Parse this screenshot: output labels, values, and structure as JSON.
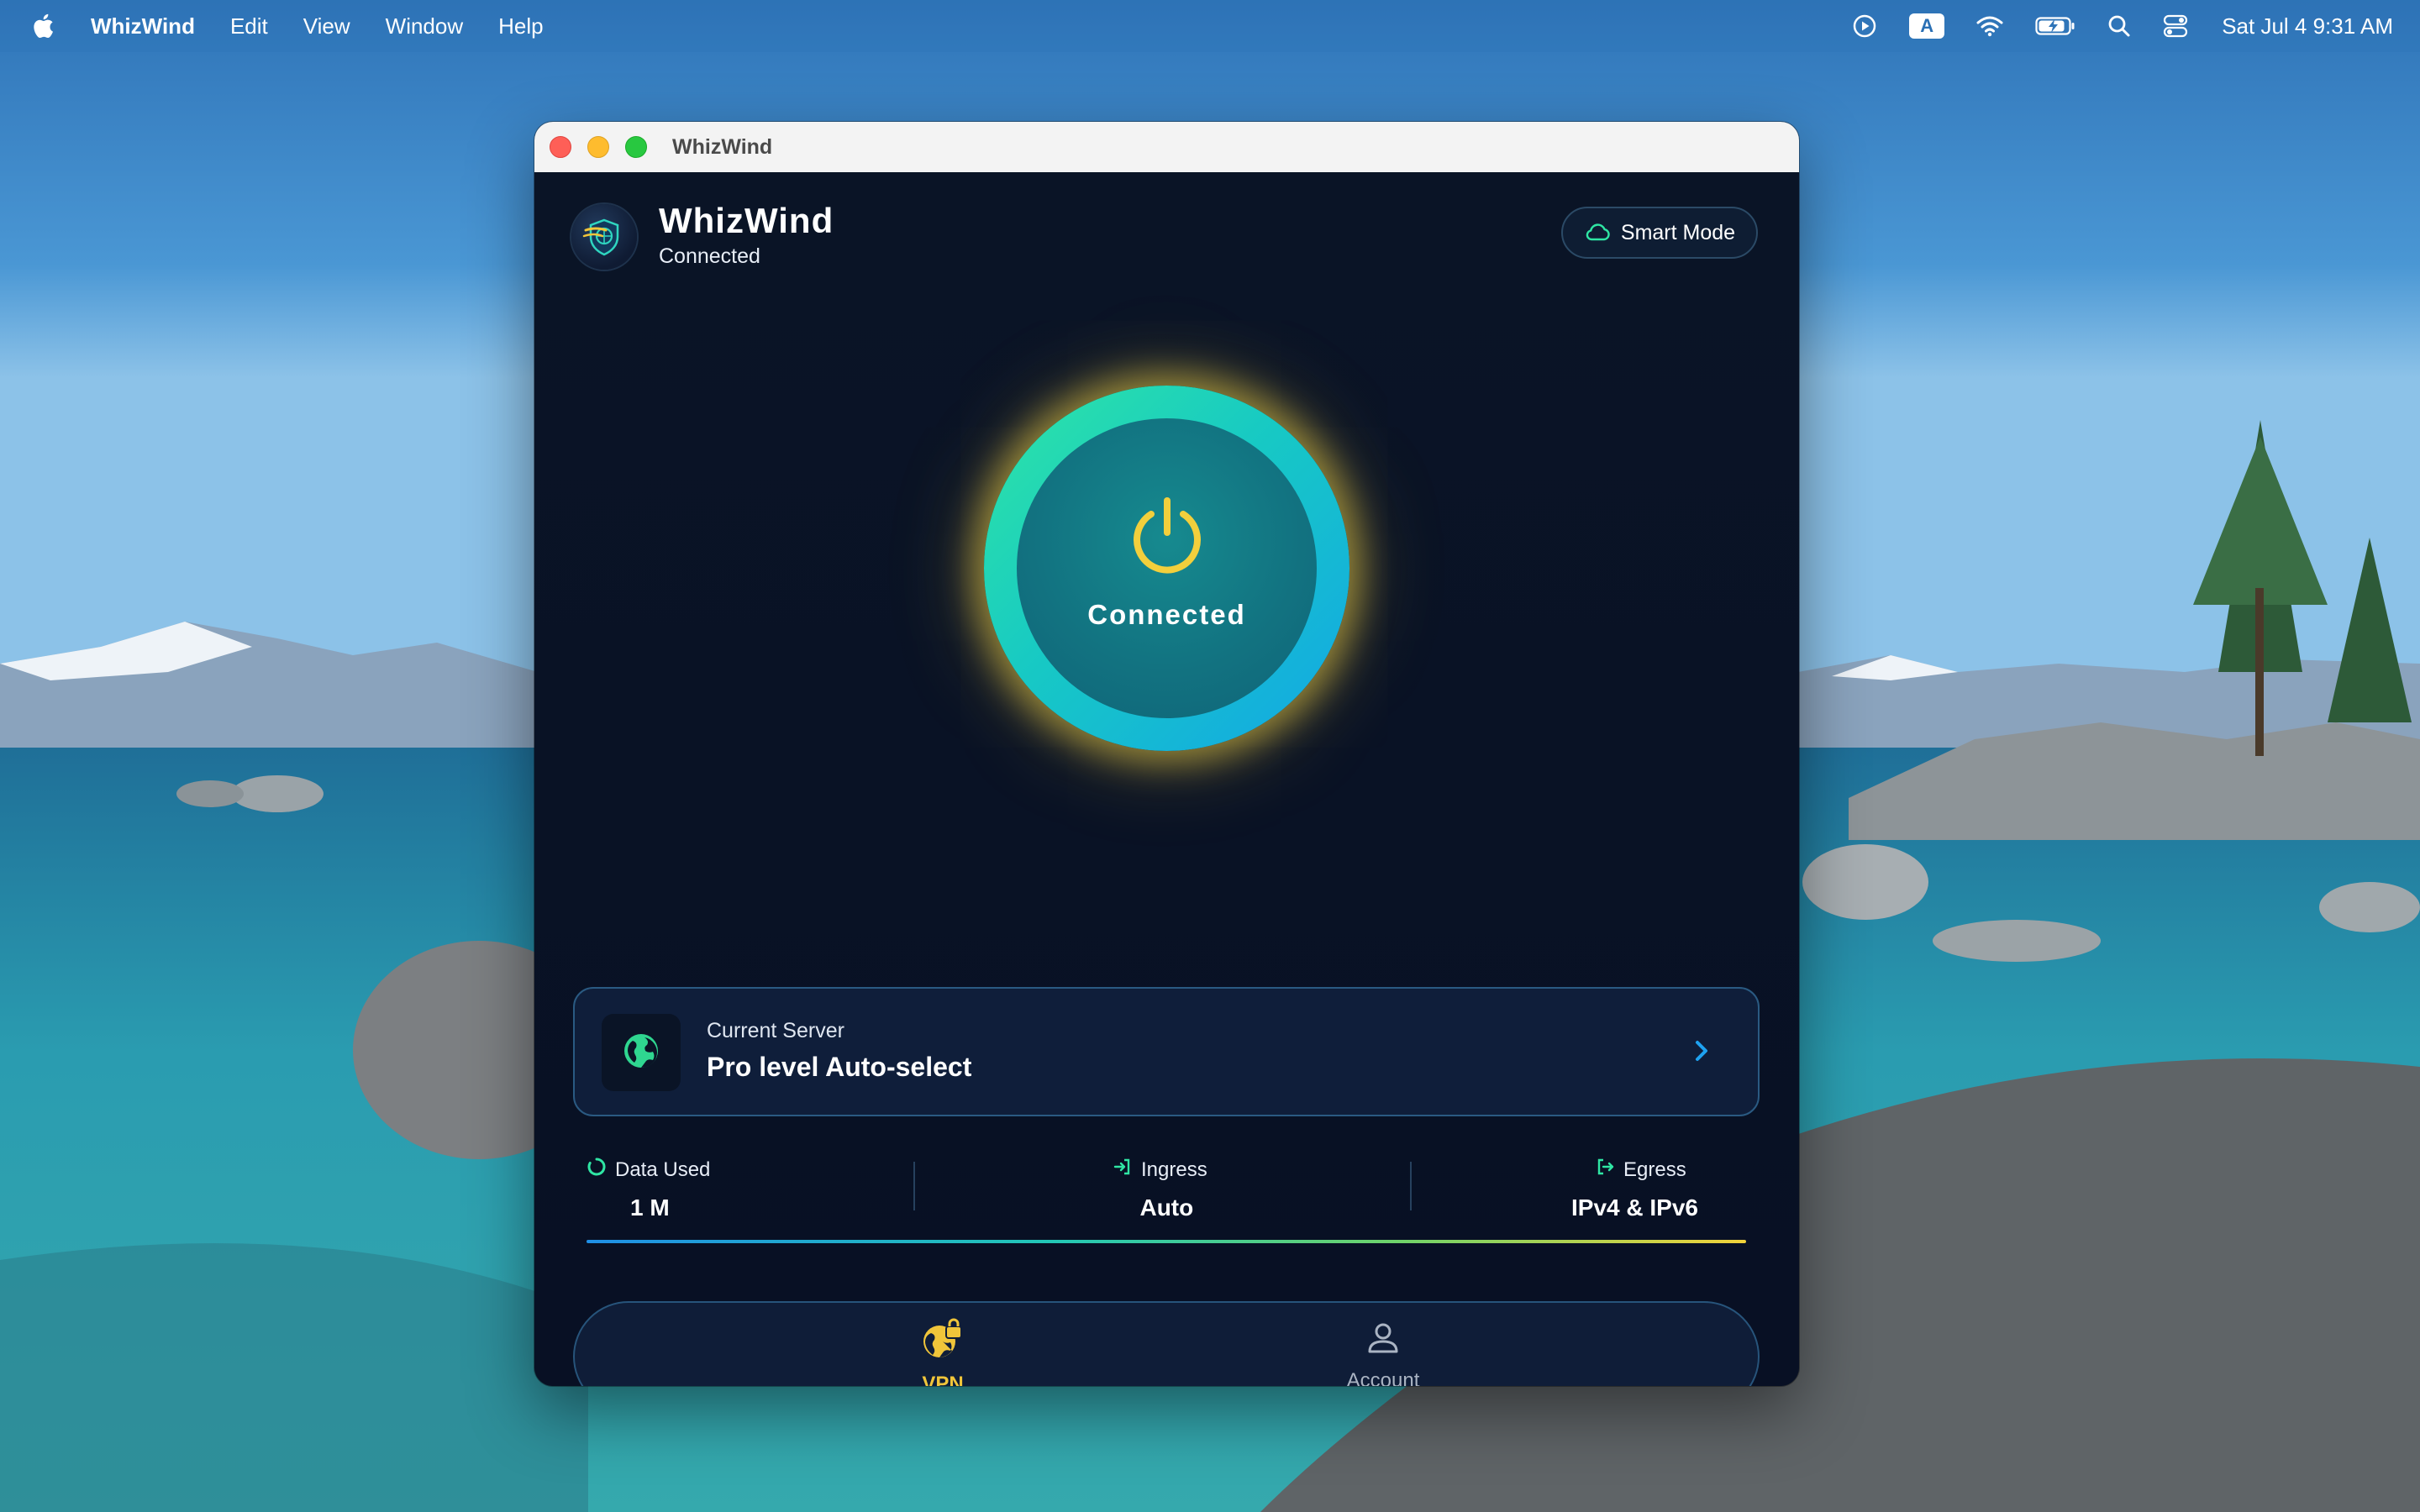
{
  "menubar": {
    "app_name": "WhizWind",
    "items": [
      "Edit",
      "View",
      "Window",
      "Help"
    ],
    "clock": "Sat Jul 4  9:31 AM",
    "input_badge": "A",
    "status_icons": [
      "play-circle-icon",
      "input-source-icon",
      "wifi-icon",
      "battery-icon",
      "search-icon",
      "control-center-icon"
    ]
  },
  "window": {
    "title": "WhizWind"
  },
  "header": {
    "app_name": "WhizWind",
    "status": "Connected",
    "smart_mode_label": "Smart Mode"
  },
  "power": {
    "label": "Connected"
  },
  "server": {
    "caption": "Current Server",
    "name": "Pro level Auto-select"
  },
  "stats": {
    "data_used": {
      "label": "Data Used",
      "value": "1 M"
    },
    "ingress": {
      "label": "Ingress",
      "value": "Auto"
    },
    "egress": {
      "label": "Egress",
      "value": "IPv4 & IPv6"
    }
  },
  "tabs": {
    "vpn": "VPN",
    "account": "Account"
  },
  "colors": {
    "accent_green": "#2fe6a4",
    "accent_blue": "#13a6e6",
    "accent_yellow": "#f0c53a",
    "background": "#0b1427"
  }
}
